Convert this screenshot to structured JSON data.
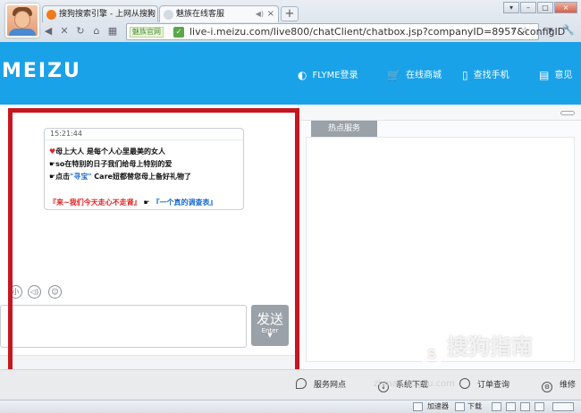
{
  "browser": {
    "tabs": [
      {
        "title": "搜狗搜索引擎 - 上网从搜狗",
        "close": "×"
      },
      {
        "title": "魅族在线客服",
        "close": "×"
      }
    ],
    "new_tab": "+",
    "url_site_label": "魅族官网",
    "url": "live-i.meizu.com/live800/chatClient/chatbox.jsp?companyID=8957&configID",
    "window_buttons": [
      "▾",
      "–",
      "□",
      "×"
    ]
  },
  "site": {
    "logo": "MEIZU",
    "nav": [
      {
        "label": "FLYME登录",
        "icon": "flyme-icon"
      },
      {
        "label": "在线商城",
        "icon": "cart-icon"
      },
      {
        "label": "查找手机",
        "icon": "phone-icon"
      },
      {
        "label": "意见",
        "icon": "document-icon"
      }
    ]
  },
  "chat": {
    "message": {
      "time": "15:21:44",
      "line1": "母上大人 是每个人心里最美的女人",
      "line2": "so在特别的日子我们给母上特别的爱",
      "line3_prefix": "点击",
      "line3_link": "\"寻宝\"",
      "line3_suffix": " Care妞都替您母上备好礼物了",
      "line4_red": "『来~我们今天走心不走肾』",
      "line4_blue": "『一个真的调查表』"
    },
    "send": {
      "label": "发送",
      "hint": "Enter"
    }
  },
  "side_panel": {
    "tab": "热点服务"
  },
  "footer": [
    {
      "label": "服务网点"
    },
    {
      "label": "系统下载"
    },
    {
      "label": "订单查询"
    },
    {
      "label": "维修"
    }
  ],
  "watermark": {
    "text": "搜狗指南",
    "url": "zhinan.sogou.com"
  },
  "statusbar": {
    "accelerator": "加速器",
    "download": "下载"
  }
}
